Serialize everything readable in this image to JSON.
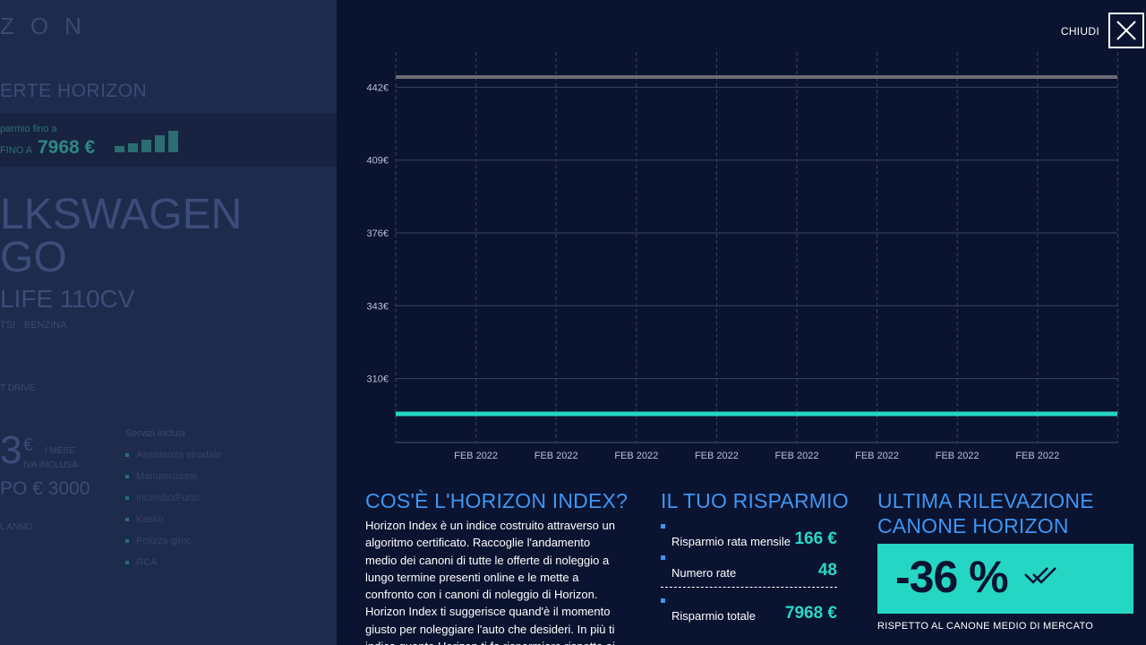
{
  "background": {
    "logo": "ZON",
    "offers_title": "ERTE HORIZON",
    "banner_small": "parmio fino a",
    "banner_fino": "FINO A",
    "banner_amount": "7968 €",
    "brand": "LKSWAGEN",
    "brand_line2": "GO",
    "model": "LIFE 110CV",
    "specs": "TSI  ·  BENZINA",
    "drive": "T DRIVE",
    "price_big": "3",
    "price_euro": "€",
    "price_mese": "/ MESE",
    "iva": "IVA INCLUSA",
    "anticipo": "PO € 3000",
    "anno": "L ANNO",
    "services_title": "Servizi inclusi",
    "services": [
      "Assistenza stradale",
      "Manutenzione",
      "Incendio/Furto",
      "Kasko",
      "Polizza gimc",
      "RCA"
    ]
  },
  "modal": {
    "close_label": "CHIUDI",
    "close_icon": "close-x-icon"
  },
  "chart_data": {
    "type": "line",
    "x": [
      "FEB 2022",
      "FEB 2022",
      "FEB 2022",
      "FEB 2022",
      "FEB 2022",
      "FEB 2022",
      "FEB 2022",
      "FEB 2022"
    ],
    "y_ticks": [
      "442€",
      "409€",
      "376€",
      "343€",
      "310€"
    ],
    "ylim": [
      281,
      458
    ],
    "series": [
      {
        "values": [
          460,
          460,
          460,
          460,
          460,
          460,
          460,
          460,
          460,
          460
        ],
        "color": "#6a6c74"
      },
      {
        "values": [
          294,
          294,
          294,
          294,
          294,
          294,
          294,
          294,
          294,
          294
        ],
        "color": "#26d6c4"
      }
    ],
    "grid": true
  },
  "index_section": {
    "title": "COS'È L'HORIZON INDEX?",
    "body": "Horizon Index è un indice costruito attraverso un algoritmo certificato. Raccoglie l'andamento medio dei canoni di tutte le offerte di noleggio a lungo termine presenti online e le mette a confronto con i canoni di noleggio di Horizon. Horizon Index ti suggerisce quand'è il momento giusto per noleggiare l'auto che desideri. In più ti indica quanto Horizon ti fa risparmiare rispetto ai"
  },
  "risparmio": {
    "title": "IL TUO RISPARMIO",
    "rows": [
      {
        "label": "Risparmio rata mensile",
        "value": "166 €"
      },
      {
        "label": "Numero rate",
        "value": "48"
      },
      {
        "label": "Risparmio totale",
        "value": "7968 €"
      }
    ]
  },
  "ultima": {
    "title_line1": "ULTIMA RILEVAZIONE",
    "title_line2": "CANONE HORIZON",
    "percent": "-36 %",
    "caption": "RISPETTO AL CANONE MEDIO DI MERCATO"
  },
  "colors": {
    "accent_blue": "#3f96f2",
    "accent_teal": "#26d6c4",
    "modal_bg": "#0a1330"
  }
}
